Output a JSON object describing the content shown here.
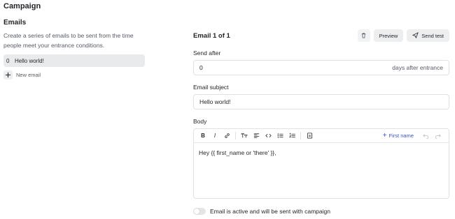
{
  "page": {
    "title": "Campaign"
  },
  "emails_section": {
    "title": "Emails",
    "description_line1": "Create a series of emails to be sent from the time",
    "description_line2": "people meet your entrance conditions.",
    "items": [
      {
        "number": "0",
        "name": "Hello world!"
      }
    ],
    "new_email_label": "New email"
  },
  "editor": {
    "counter": "Email 1 of 1",
    "preview_label": "Preview",
    "send_test_label": "Send test",
    "send_after": {
      "label": "Send after",
      "value": "0",
      "suffix": "days after entrance"
    },
    "subject": {
      "label": "Email subject",
      "value": "Hello world!"
    },
    "body": {
      "label": "Body",
      "first_name_label": "First name",
      "content": "Hey {{ first_name or 'there' }},"
    },
    "active_toggle": {
      "label": "Email is active and will be sent with campaign",
      "on": false
    }
  },
  "colors": {
    "accent": "#3b4fd1",
    "border": "#dfe1e4",
    "selected_bg": "#e9eaec"
  },
  "icons": [
    "trash-icon",
    "send-icon",
    "plus-icon",
    "bold-icon",
    "italic-icon",
    "link-icon",
    "text-size-icon",
    "align-icon",
    "code-icon",
    "bullet-list-icon",
    "numbered-list-icon",
    "image-icon",
    "undo-icon",
    "redo-icon"
  ]
}
